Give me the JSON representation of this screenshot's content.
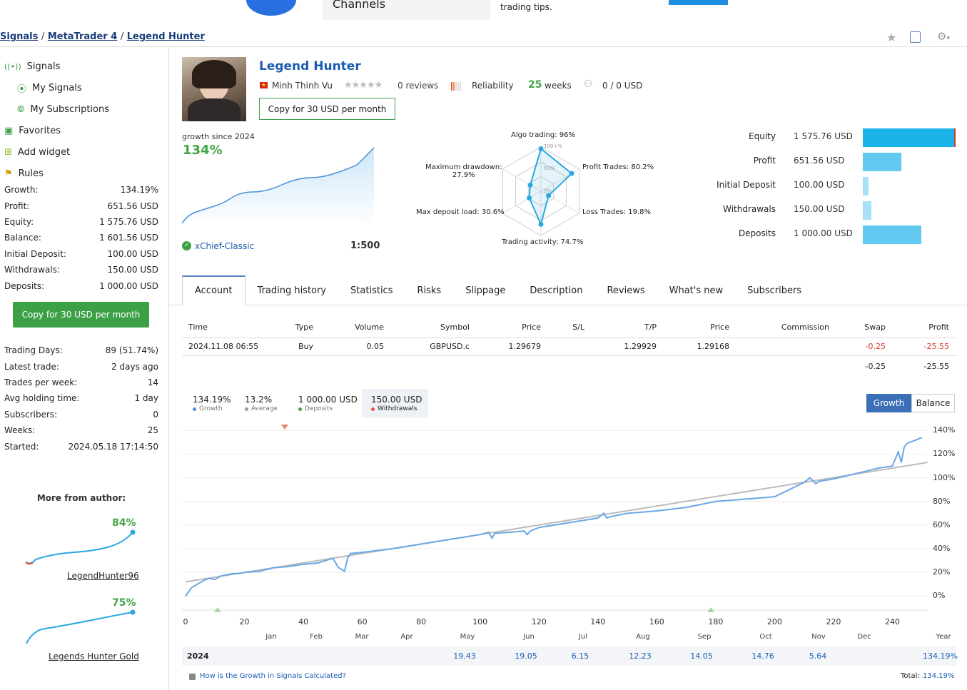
{
  "banner": {
    "channels": "Channels",
    "tips": "trading tips."
  },
  "breadcrumb": {
    "signals": "Signals",
    "platform": "MetaTrader 4",
    "current": "Legend Hunter",
    "sep": "/"
  },
  "sidebar": {
    "nav": [
      {
        "label": "Signals"
      },
      {
        "label": "My Signals"
      },
      {
        "label": "My Subscriptions"
      },
      {
        "label": "Favorites"
      },
      {
        "label": "Add widget"
      },
      {
        "label": "Rules"
      }
    ],
    "stats": [
      {
        "k": "Growth:",
        "v": "134.19%"
      },
      {
        "k": "Profit:",
        "v": "651.56 USD"
      },
      {
        "k": "Equity:",
        "v": "1 575.76 USD"
      },
      {
        "k": "Balance:",
        "v": "1 601.56 USD"
      },
      {
        "k": "Initial Deposit:",
        "v": "100.00 USD"
      },
      {
        "k": "Withdrawals:",
        "v": "150.00 USD"
      },
      {
        "k": "Deposits:",
        "v": "1 000.00 USD"
      }
    ],
    "copy_button": "Copy for 30 USD per month",
    "stats2": [
      {
        "k": "Trading Days:",
        "v": "89 (51.74%)"
      },
      {
        "k": "Latest trade:",
        "v": "2 days ago"
      },
      {
        "k": "Trades per week:",
        "v": "14"
      },
      {
        "k": "Avg holding time:",
        "v": "1 day"
      },
      {
        "k": "Subscribers:",
        "v": "0"
      },
      {
        "k": "Weeks:",
        "v": "25"
      },
      {
        "k": "Started:",
        "v": "2024.05.18 17:14:50"
      }
    ],
    "more_from_author": "More from author:",
    "author_signals": [
      {
        "name": "LegendHunter96",
        "growth": "84%"
      },
      {
        "name": "Legends Hunter Gold",
        "growth": "75%"
      }
    ]
  },
  "signal": {
    "title": "Legend Hunter",
    "author": "Minh Thinh Vu",
    "reviews": "0 reviews",
    "reliability": "Reliability",
    "weeks_num": "25",
    "weeks_label": "weeks",
    "subscribers": "0 / 0 USD",
    "copy_button": "Copy for 30 USD per month",
    "growth_since": "growth since 2024",
    "growth_value": "134%",
    "broker": "xChief-Classic",
    "leverage": "1:500"
  },
  "radar": {
    "algo": "Algo trading: 96%",
    "profit_trades": "Profit Trades: 80.2%",
    "loss_trades": "Loss Trades: 19.8%",
    "activity": "Trading activity: 74.7%",
    "deposit_load": "Max deposit load: 30.6%",
    "drawdown_1": "Maximum drawdown:",
    "drawdown_2": "27.9%",
    "scale_100": "100+%",
    "scale_50": "50%",
    "scale_0": "0%",
    "values": [
      96,
      80.2,
      19.8,
      74.7,
      30.6,
      27.9
    ]
  },
  "metrics": [
    {
      "label": "Equity",
      "value": "1 575.76 USD",
      "amount": 1575.76,
      "color": "#1bb4e8"
    },
    {
      "label": "Profit",
      "value": "651.56 USD",
      "amount": 651.56,
      "color": "#62c9f0"
    },
    {
      "label": "Initial Deposit",
      "value": "100.00 USD",
      "amount": 100.0,
      "color": "#a7e0f7"
    },
    {
      "label": "Withdrawals",
      "value": "150.00 USD",
      "amount": 150.0,
      "color": "#a7e0f7"
    },
    {
      "label": "Deposits",
      "value": "1 000.00 USD",
      "amount": 1000.0,
      "color": "#62c9f0"
    }
  ],
  "tabs": [
    "Account",
    "Trading history",
    "Statistics",
    "Risks",
    "Slippage",
    "Description",
    "Reviews",
    "What's new",
    "Subscribers"
  ],
  "trades": {
    "headers": [
      "Time",
      "Type",
      "Volume",
      "Symbol",
      "Price",
      "S/L",
      "T/P",
      "Price",
      "Commission",
      "Swap",
      "Profit"
    ],
    "rows": [
      {
        "time": "2024.11.08 06:55",
        "type": "Buy",
        "volume": "0.05",
        "symbol": "GBPUSD.c",
        "price": "1.29679",
        "sl": "",
        "tp": "1.29929",
        "price2": "1.29168",
        "commission": "",
        "swap": "-0.25",
        "profit": "-25.55"
      }
    ],
    "totals": {
      "swap": "-0.25",
      "profit": "-25.55"
    }
  },
  "chart_legend": [
    {
      "value": "134.19%",
      "label": "Growth",
      "color": "#4a90d9"
    },
    {
      "value": "13.2%",
      "label": "Average",
      "color": "#999999"
    },
    {
      "value": "1 000.00 USD",
      "label": "Deposits",
      "color": "#42a545"
    },
    {
      "value": "150.00 USD",
      "label": "Withdrawals",
      "color": "#e8553a"
    }
  ],
  "chart_toggle": {
    "growth": "Growth",
    "balance": "Balance"
  },
  "chart_data": {
    "type": "line",
    "xlim": [
      0,
      252
    ],
    "ylim": [
      -10,
      145
    ],
    "x_ticks": [
      0,
      20,
      40,
      60,
      80,
      100,
      120,
      140,
      160,
      180,
      200,
      220,
      240
    ],
    "y_ticks": [
      "140%",
      "120%",
      "100%",
      "80%",
      "60%",
      "40%",
      "20%",
      "0%"
    ],
    "y_tick_values": [
      140,
      120,
      100,
      80,
      60,
      40,
      20,
      0
    ],
    "months": [
      "Jan",
      "Feb",
      "Mar",
      "Apr",
      "May",
      "Jun",
      "Jul",
      "Aug",
      "Sep",
      "Oct",
      "Nov",
      "Dec",
      "Year"
    ],
    "series": [
      {
        "name": "Growth",
        "x": [
          0,
          2,
          4,
          6,
          8,
          10,
          12,
          14,
          16,
          18,
          20,
          25,
          30,
          35,
          40,
          45,
          50,
          52,
          54,
          55,
          56,
          60,
          70,
          80,
          90,
          100,
          103,
          104,
          105,
          110,
          115,
          116,
          117,
          120,
          130,
          140,
          142,
          143,
          144,
          150,
          160,
          170,
          180,
          190,
          200,
          205,
          210,
          212,
          214,
          215,
          220,
          225,
          230,
          235,
          240,
          242,
          243,
          244,
          245,
          248,
          250
        ],
        "y": [
          0,
          7,
          10,
          13,
          15,
          14,
          17,
          18,
          19,
          19,
          20,
          21,
          24,
          25,
          27,
          28,
          32,
          24,
          21,
          32,
          36,
          37,
          40,
          44,
          48,
          52,
          54,
          49,
          53,
          54,
          55,
          52,
          55,
          58,
          62,
          66,
          70,
          66,
          67,
          70,
          72,
          75,
          80,
          82,
          84,
          90,
          96,
          100,
          95,
          97,
          99,
          102,
          105,
          108,
          110,
          122,
          113,
          126,
          129,
          132,
          134
        ]
      },
      {
        "name": "Average",
        "x": [
          0,
          252
        ],
        "y": [
          12,
          113
        ]
      }
    ]
  },
  "monthly": {
    "year": "2024",
    "values": [
      {
        "m": "May",
        "v": "19.43"
      },
      {
        "m": "Jun",
        "v": "19.05"
      },
      {
        "m": "Jul",
        "v": "6.15"
      },
      {
        "m": "Aug",
        "v": "12.23"
      },
      {
        "m": "Sep",
        "v": "14.05"
      },
      {
        "m": "Oct",
        "v": "14.76"
      },
      {
        "m": "Nov",
        "v": "5.64"
      }
    ],
    "year_total": "134.19%",
    "total_label": "Total:",
    "total_value": "134.19%",
    "howto": "How is the Growth in Signals Calculated?"
  }
}
